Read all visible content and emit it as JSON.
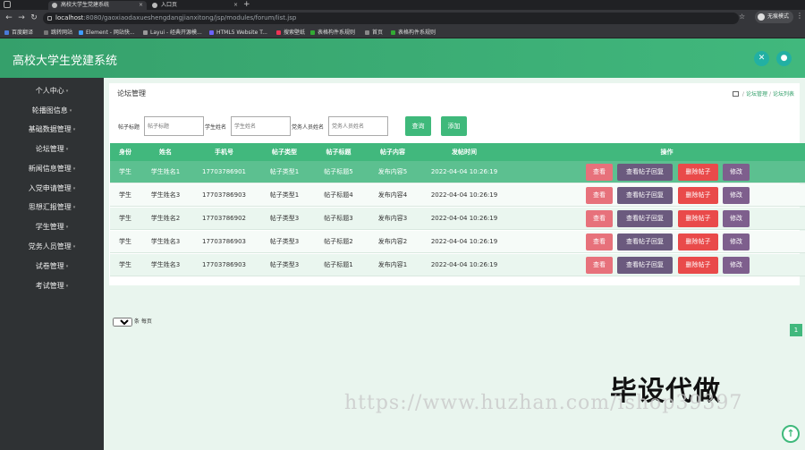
{
  "browser": {
    "tabs": [
      {
        "title": "高校大学生党建系统",
        "active": true
      },
      {
        "title": "入口页",
        "active": false
      }
    ],
    "url_host": "localhost",
    "url_path": ":8080/gaoxiaodaxueshengdangjianxitong/jsp/modules/forum/list.jsp",
    "profile_label": "无痕模式",
    "bookmarks": [
      "百度翻译",
      "跳转网站",
      "Element - 网站快...",
      "Layui - 经典开源模...",
      "HTML5 Website T...",
      "搜索壁纸",
      "表格构件系规则",
      "首页",
      "表格构件系规则"
    ]
  },
  "app": {
    "title": "高校大学生党建系统",
    "colors": {
      "primary": "#41b87d",
      "sidebar": "#2f3234",
      "danger": "#e94a4a",
      "purple": "#6b5a7e",
      "pink": "#e7717b"
    }
  },
  "sidebar": {
    "items": [
      "个人中心",
      "轮播图信息",
      "基础数据管理",
      "论坛管理",
      "新闻信息管理",
      "入党申请管理",
      "思想汇报管理",
      "学生管理",
      "党务人员管理",
      "试卷管理",
      "考试管理"
    ]
  },
  "page": {
    "title": "论坛管理",
    "breadcrumb": [
      "论坛管理",
      "论坛列表"
    ]
  },
  "filters": {
    "post_title_label": "帖子标题",
    "post_title_placeholder": "帖子标题",
    "student_name_label": "学生姓名",
    "student_name_placeholder": "学生姓名",
    "staff_name_label": "党务人员姓名",
    "staff_name_placeholder": "党务人员姓名",
    "search_button": "查询",
    "add_button": "添加"
  },
  "table": {
    "headers": [
      "身份",
      "姓名",
      "手机号",
      "帖子类型",
      "帖子标题",
      "帖子内容",
      "发帖时间",
      "操作"
    ],
    "action_labels": {
      "view": "查看",
      "view_reply": "查看帖子回复",
      "delete": "删除帖子",
      "edit": "修改"
    },
    "rows": [
      {
        "role": "学生",
        "name": "学生姓名1",
        "phone": "17703786901",
        "type": "帖子类型1",
        "title": "帖子标题5",
        "content": "发布内容5",
        "time": "2022-04-04 10:26:19"
      },
      {
        "role": "学生",
        "name": "学生姓名3",
        "phone": "17703786903",
        "type": "帖子类型1",
        "title": "帖子标题4",
        "content": "发布内容4",
        "time": "2022-04-04 10:26:19"
      },
      {
        "role": "学生",
        "name": "学生姓名2",
        "phone": "17703786902",
        "type": "帖子类型3",
        "title": "帖子标题3",
        "content": "发布内容3",
        "time": "2022-04-04 10:26:19"
      },
      {
        "role": "学生",
        "name": "学生姓名3",
        "phone": "17703786903",
        "type": "帖子类型3",
        "title": "帖子标题2",
        "content": "发布内容2",
        "time": "2022-04-04 10:26:19"
      },
      {
        "role": "学生",
        "name": "学生姓名3",
        "phone": "17703786903",
        "type": "帖子类型3",
        "title": "帖子标题1",
        "content": "发布内容1",
        "time": "2022-04-04 10:26:19"
      }
    ]
  },
  "pager": {
    "page_size": "10",
    "suffix": "条 每页",
    "current_page": "1"
  },
  "watermark": {
    "main": "毕设代做",
    "url": "https://www.huzhan.com/ishop39397"
  }
}
